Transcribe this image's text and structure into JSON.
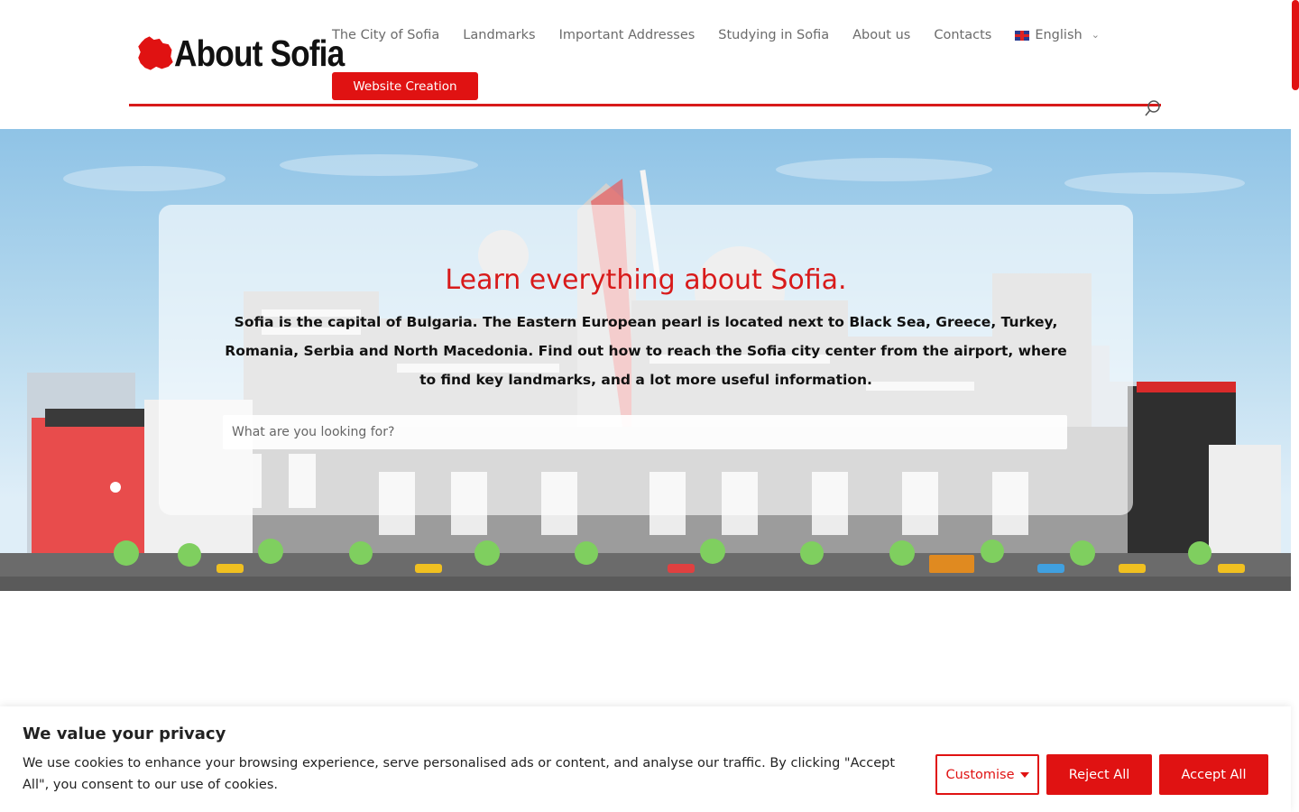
{
  "header": {
    "logo_text": "About Sofia",
    "nav": [
      {
        "label": "The City of Sofia"
      },
      {
        "label": "Landmarks"
      },
      {
        "label": "Important Addresses"
      },
      {
        "label": "Studying in Sofia"
      },
      {
        "label": "About us"
      },
      {
        "label": "Contacts"
      }
    ],
    "language": "English",
    "cta_label": "Website Creation"
  },
  "hero": {
    "title": "Learn everything about Sofia.",
    "text": "Sofia is the capital of Bulgaria. The Eastern European pearl is located next to Black Sea, Greece, Turkey, Romania, Serbia and North Macedonia. Find out how to reach the Sofia city center from the airport, where to find key landmarks, and a lot more useful information.",
    "search_placeholder": "What are you looking for?"
  },
  "cookie": {
    "title": "We value your privacy",
    "text": "We use cookies to enhance your browsing experience, serve personalised ads or content, and analyse our traffic. By clicking \"Accept All\", you consent to our use of cookies.",
    "customise_label": "Customise",
    "reject_label": "Reject All",
    "accept_label": "Accept All"
  },
  "colors": {
    "accent": "#e01212",
    "title_red": "#d81a1a",
    "nav_text": "#6b6b6b"
  }
}
